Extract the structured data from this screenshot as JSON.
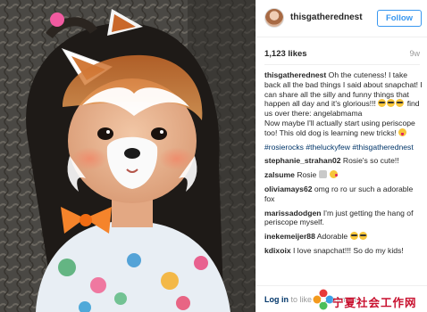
{
  "post": {
    "username": "thisgatherednest",
    "follow_label": "Follow",
    "likes": "1,123 likes",
    "age": "9w",
    "caption_lines": [
      "Oh the cuteness! I take back all the bad things I said about snapchat! I can share all the silly and funny things that happen all day and it's glorious!!!",
      "find us over there: angelabmama",
      "Now maybe I'll actually start using periscope too! This old dog is learning new tricks!"
    ],
    "hashtags": "#rosierocks #theluckyfew #thisgatherednest"
  },
  "comments": [
    {
      "user": "stephanie_strahan02",
      "text": "Rosie's so cute!!"
    },
    {
      "user": "zalsume",
      "text": "Rosie"
    },
    {
      "user": "oliviamays62",
      "text": "omg ro ro ur such a adorable fox"
    },
    {
      "user": "marissadodgen",
      "text": "I'm just getting the hang of periscope myself."
    },
    {
      "user": "inekemeijer88",
      "text": "Adorable"
    },
    {
      "user": "kdixoix",
      "text": "I love snapchat!!! So do my kids!"
    }
  ],
  "footer": {
    "login": "Log in",
    "rest": " to like or comment."
  },
  "watermark": {
    "text": "宁夏社会工作网"
  },
  "icons": {
    "avatar": "profile-avatar",
    "watermark_logo": "ns-flower-logo"
  },
  "colors": {
    "follow_blue": "#3897f0",
    "hashtag_navy": "#003569",
    "watermark_red": "#c8102e"
  }
}
